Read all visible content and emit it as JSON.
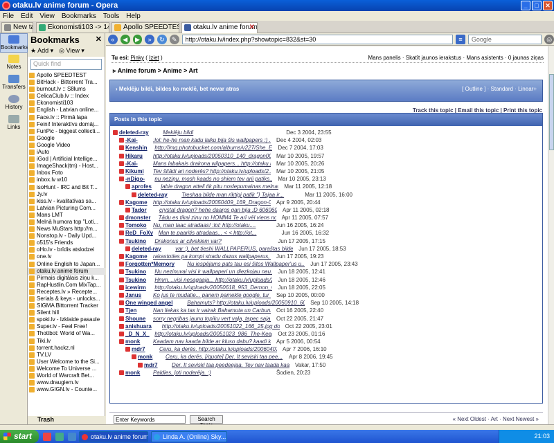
{
  "window": {
    "title": "otaku.lv anime forum - Opera"
  },
  "menu": [
    "File",
    "Edit",
    "View",
    "Bookmarks",
    "Tools",
    "Help"
  ],
  "tabs": [
    {
      "label": "New tab"
    },
    {
      "label": "Ekonomisti103 -> 14. Ap..."
    },
    {
      "label": "Apollo SPEEDTEST"
    },
    {
      "label": "otaku.lv anime forum"
    }
  ],
  "panels": [
    "Bookmarks",
    "Notes",
    "Transfers",
    "History",
    "Links"
  ],
  "bookmarks_panel": {
    "title": "Bookmarks",
    "add": "Add",
    "view": "View",
    "search_placeholder": "Quick find",
    "items": [
      "Apollo SPEEDTEST",
      "BitHack - Bittorrent Tra...",
      "burnout.lv :: S8lums",
      "CelicaClub.lv :: Index",
      "Ekonomisti103",
      "English - Latvian online...",
      "Face.lv :: Pirmā lapa",
      "Feini! Interaktīvs domāj...",
      "FunPic - biggest collecti...",
      "Google",
      "Google Video",
      "iAuto",
      "iGod | Artificial Intellige...",
      "ImageShack(tm) - Host...",
      "Inbox Foto",
      "inbox.lv w10",
      "isoHunt - IRC and Bit T...",
      "Jy.lv",
      "kiss.lv - kvalitatīvas sa...",
      "Latvian Picturing Com...",
      "Mans LMT",
      "Melnā humora top \"Loti...",
      "News MuStars http://m...",
      "Nonstop.lv - Daily Upd...",
      "o515's Friends",
      "oHo.lv - brīdis atslodzei",
      "one.lv",
      "Online English to Japan...",
      "otaku.lv anime forum",
      "Pirmais digitālais ziņu k...",
      "RapHustlin.Com MixTap...",
      "Receptes.lv » Recepte...",
      "Serials & keys - unlocks...",
      "SIGMA Bittorrent Tracker",
      "Silent hill",
      "spoki.lv - Izklaide pasaule",
      "Super.lv - Feel Free!",
      "Thottbot: World of Wa...",
      "Tiki.lv",
      "torrent.hackz.nl",
      "TV.LV",
      "User Welcome to the Si...",
      "Welcome To Universe ...",
      "World of Warcraft Bet...",
      "www.draugiem.lv",
      "www.GIGN.lv - Counte..."
    ],
    "selected_index": 28,
    "trash": "Trash"
  },
  "address": {
    "url": "http://otaku.lv/index.php?showtopic=832&st=30",
    "search_placeholder": "Google"
  },
  "forum": {
    "user_prefix": "Tu esi:",
    "user_name": "Pinky",
    "logout": "Iziet",
    "user_links": "Mans panelis · Skatīt jaunos ierakstus · Mans asistents · 0 jaunas ziņas",
    "breadcrumb": "Anime forum > Anime > Art",
    "topic_title": "› Meklēju bildi, bildes ko meklē, bet nevar atras",
    "view_modes": "[ Outline ] · Standard · Linear+",
    "thread_tools": "Track this topic | Email this topic | Print this topic",
    "posts_header": "Posts in this topic",
    "posts": [
      {
        "depth": 0,
        "name": "deleted-ray",
        "preview": "Meklēju bildi",
        "date": "Dec 3 2004, 23:55"
      },
      {
        "depth": 1,
        "name": "-Kai-",
        "preview": ":lol: he-he man kadu laiku bija šis wallpapers :) ...",
        "date": "Dec 4 2004, 02:03"
      },
      {
        "depth": 1,
        "name": "Kenshin",
        "preview": "http://img.photobucket.com/albums/v227/She_Elf/wal...",
        "date": "Dec 7 2004, 17:03"
      },
      {
        "depth": 1,
        "name": "Hikaru",
        "preview": "http://otaku.lv/uploads/20050310_140_dragon001.jpg...",
        "date": "Mar 10 2005, 19:57"
      },
      {
        "depth": 1,
        "name": "-Kai-",
        "preview": "Mans labakais drakona wilpapers... http://otaku.lv...",
        "date": "Mar 10 2005, 20:26"
      },
      {
        "depth": 1,
        "name": "Kikumi",
        "preview": "Tev šitādi ari noderēs? http://otaku.lv/uploads/2...",
        "date": "Mar 10 2005, 21:05"
      },
      {
        "depth": 1,
        "name": "-nDigo-",
        "preview": "nu neziņu, mosh kaads no shiem tev arii patiks....",
        "date": "Mar 10 2005, 23:13"
      },
      {
        "depth": 2,
        "name": "aprofes",
        "preview": "ļabie dragon atteli tik pitu noslepumainas melnas...",
        "date": "Mar 11 2005, 12:18"
      },
      {
        "depth": 3,
        "name": "deleted-ray",
        "preview": "Treshaa bilde man riktigi patīk \"} Tajaa ir...",
        "date": "Mar 11 2005, 16:00"
      },
      {
        "depth": 1,
        "name": "Kagome",
        "preview": "http://otaku.lv/uploads/20050409_169_Dragon-001.jp...",
        "date": "Apr 9 2005, 20:44"
      },
      {
        "depth": 2,
        "name": "Tador",
        "preview": "crystal dragon? hehe daargs gan bija :D 606060606...",
        "date": "Apr 11 2005, 02:18"
      },
      {
        "depth": 1,
        "name": "dmonster",
        "preview": "Tādu es tikai zinu no HOMM4 Te arī vēl viens no HO...",
        "date": "Apr 11 2005, 07:57"
      },
      {
        "depth": 1,
        "name": "Tomoko",
        "preview": "Nu, man taac atradaas! :lol: http://otaku....",
        "date": "Jun 16 2005, 16:24"
      },
      {
        "depth": 1,
        "name": "ReD_FoXy",
        "preview": "Man te paaritis atradaas... < < http://ot...",
        "date": "Jun 16 2005, 16:32"
      },
      {
        "depth": 1,
        "name": "Tsukino",
        "preview": "Drakonus ar cilvekiem var?",
        "date": "Jun 17 2005, 17:15"
      },
      {
        "depth": 2,
        "name": "deleted-ray",
        "preview": "var :), bet tieshi WALLPAPERUS, paraštas bildes ne",
        "date": "Jun 17 2005, 18:53"
      },
      {
        "depth": 1,
        "name": "Kagome",
        "preview": "rakastoties pa kompi stradu dazus wallpaperus, cer...",
        "date": "Jun 17 2005, 19:23"
      },
      {
        "depth": 1,
        "name": "Forgotten*Memory",
        "preview": "Nu iespējams pats tau esi šitos Wallpaper'us u...",
        "date": "Jun 17 2005, 23:43"
      },
      {
        "depth": 1,
        "name": "Tsukino",
        "preview": "Nu nezinuvai visi ir wallpaperi un diezkojau nau...",
        "date": "Jun 18 2005, 12:41"
      },
      {
        "depth": 1,
        "name": "Tsukino",
        "preview": "Hmm....visi nesagaaja... http://otaku.lv/uploads/20...",
        "date": "Jun 18 2005, 12:46"
      },
      {
        "depth": 1,
        "name": "icewirm",
        "preview": "http://otaku.lv/uploads/20050618_953_Demon_s_Lega...",
        "date": "Jun 18 2005, 22:05"
      },
      {
        "depth": 1,
        "name": "Janus",
        "preview": "Ko jus te mudatie... panem pamekle google, tur teu...",
        "date": "Sep 10 2005, 00:00"
      },
      {
        "depth": 1,
        "name": "One winged angel",
        "preview": "Bahamuts? http://otaku.lv/uploads/20050910_601...",
        "date": "Sep 10 2005, 14:18"
      },
      {
        "depth": 1,
        "name": "Tjen",
        "preview": "Nan liekas ka tax ir vairak Bahamuta un Carbunkula...",
        "date": "Oct 16 2005, 22:40"
      },
      {
        "depth": 1,
        "name": "Shoune",
        "preview": "sorry negribas jaunu topiku vert vaļa, tapec saja ...",
        "date": "Oct 22 2005, 21:47"
      },
      {
        "depth": 1,
        "name": "anishuara",
        "preview": "http://otaku.lv/uploads/20051022_166_25.jpg domaj...",
        "date": "Oct 22 2005, 23:01"
      },
      {
        "depth": 1,
        "name": "_D_N_X_",
        "preview": "http://otaku.lv/uploads/20051023_986_The-Keeper-of...",
        "date": "Oct 23 2005, 01:16"
      },
      {
        "depth": 1,
        "name": "monk",
        "preview": "Kaadam nav kaada bilde ar kluso dabu? kaadi kaujas...",
        "date": "Apr 5 2006, 00:54"
      },
      {
        "depth": 2,
        "name": "mdr7",
        "preview": "Ceru, ka derēs. http://otaku.lv/uploads/20060407_...",
        "date": "Apr 7 2006, 16:10"
      },
      {
        "depth": 3,
        "name": "monk",
        "preview": "Ceru, ka derēs. [/quote] Der. It seviski taa pee...",
        "date": "Apr 8 2006, 19:45"
      },
      {
        "depth": 4,
        "name": "mdr7",
        "preview": "Der. It seviski taa peedeejaa. Tev nav taada kaa ...",
        "date": "Vakar, 17:50"
      },
      {
        "depth": 1,
        "name": "monk",
        "preview": "Paldies, ļoti noderēja. :)",
        "date": "Šodien, 20:23"
      }
    ],
    "keywords_placeholder": "Enter Keywords",
    "search_button": "Search Topic",
    "pager": "« Next Oldest · Art · Next Newest »"
  },
  "taskbar": {
    "start": "start",
    "tasks": [
      {
        "label": "otaku.lv anime forum..."
      },
      {
        "label": "Linda A. (Online) Sky..."
      }
    ],
    "clock": "21:03"
  }
}
